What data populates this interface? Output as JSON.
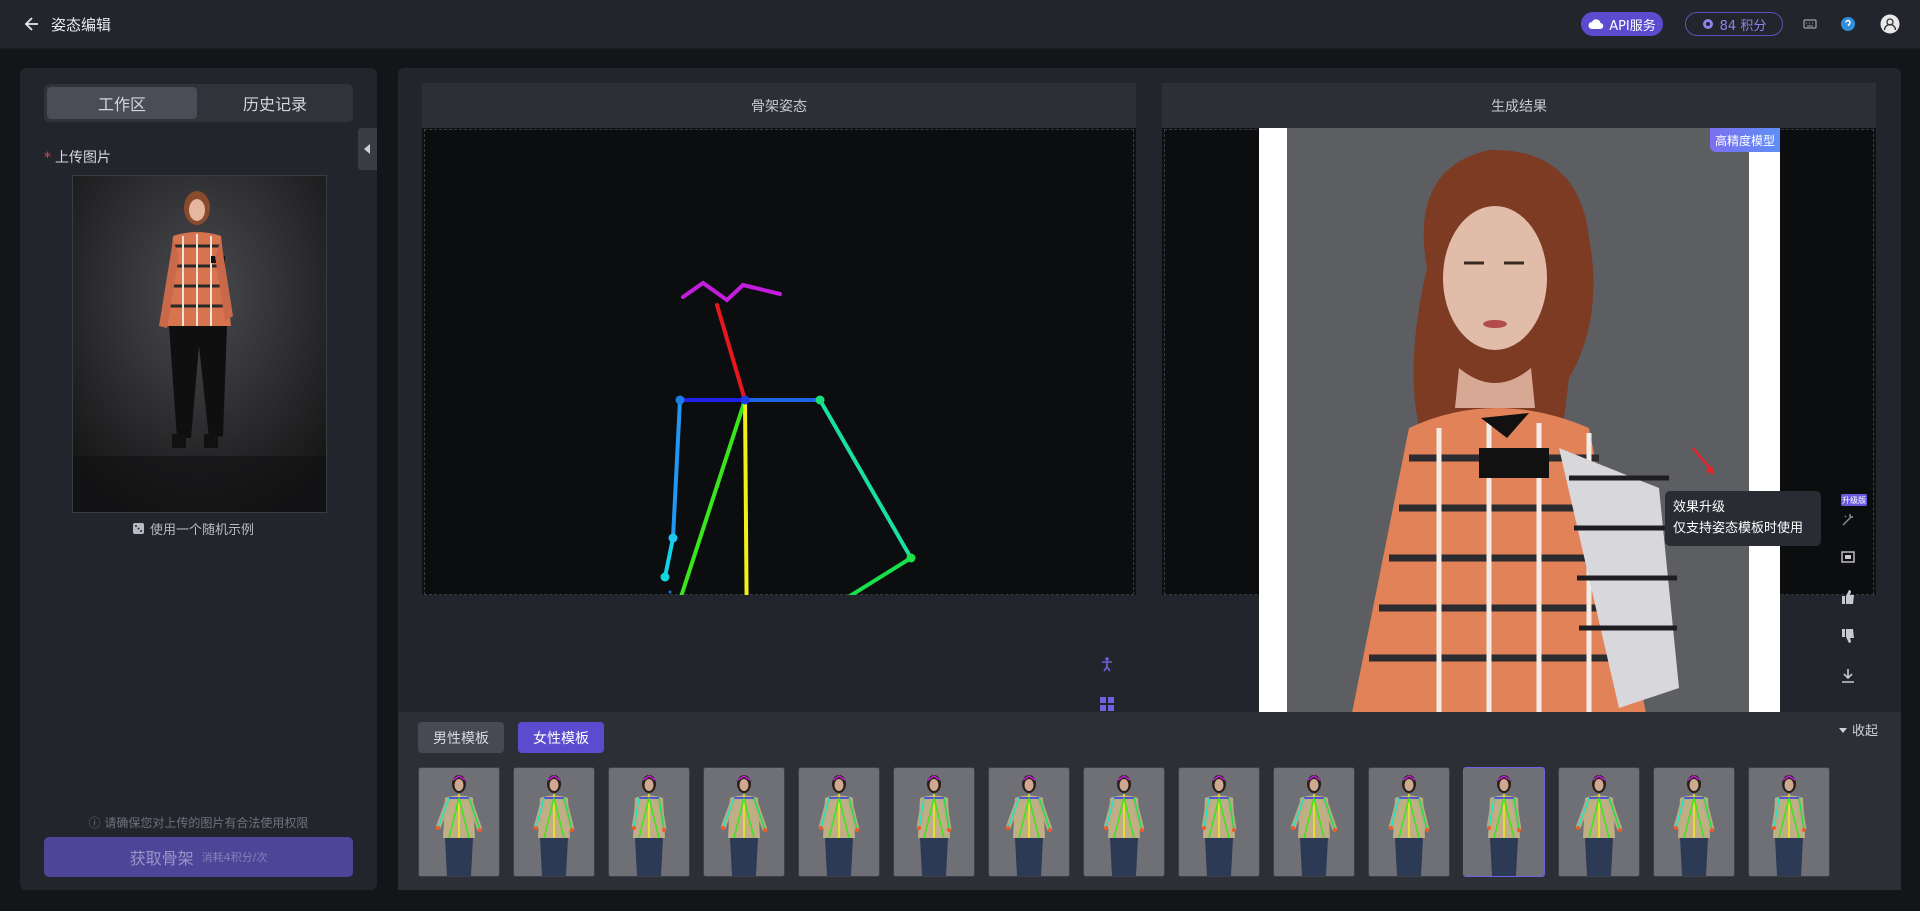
{
  "header": {
    "title": "姿态编辑",
    "api_label": "API服务",
    "points_label": "84 积分"
  },
  "left": {
    "tab_workspace": "工作区",
    "tab_history": "历史记录",
    "upload_label": "上传图片",
    "upload_required": "*",
    "random_example": "使用一个随机示例",
    "notice": "ⓘ 请确保您对上传的图片有合法使用权限",
    "get_skeleton": "获取骨架",
    "get_skeleton_cost": "消耗4积分/次"
  },
  "panes": {
    "skeleton_title": "骨架姿态",
    "result_title": "生成结果",
    "hd_badge": "高精度模型"
  },
  "tooltip": {
    "line1": "效果升级",
    "line2": "仅支持姿态模板时使用",
    "upgrade_tag": "升级版"
  },
  "templates": {
    "male": "男性模板",
    "female": "女性模板",
    "collapse": "收起",
    "count": 15,
    "selected_index": 11
  },
  "icons": {
    "back": "arrow-left-icon",
    "api": "cloud-icon",
    "points": "coin-icon",
    "keyboard": "keyboard-icon",
    "help": "help-icon",
    "user": "user-icon"
  }
}
